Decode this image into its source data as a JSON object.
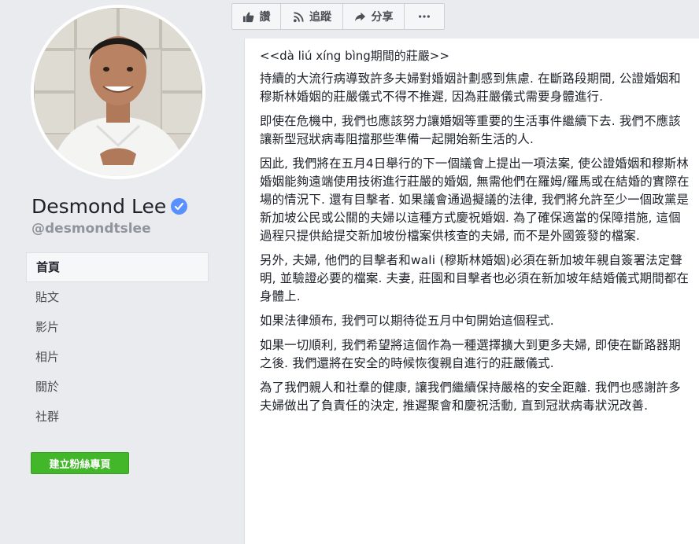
{
  "profile": {
    "name": "Desmond Lee",
    "handle": "@desmondtslee",
    "verified": true,
    "accent_color": "#5890ff"
  },
  "nav": {
    "items": [
      {
        "label": "首頁",
        "active": true
      },
      {
        "label": "貼文"
      },
      {
        "label": "影片"
      },
      {
        "label": "相片"
      },
      {
        "label": "關於"
      },
      {
        "label": "社群"
      }
    ]
  },
  "create_page_button": {
    "label": "建立粉絲專頁",
    "color": "#42b72a"
  },
  "actions": [
    {
      "label": "讚",
      "icon": "thumbs-up-icon"
    },
    {
      "label": "追蹤",
      "icon": "rss-follow-icon"
    },
    {
      "label": "分享",
      "icon": "share-arrow-icon"
    },
    {
      "label": "",
      "icon": "more-dots-icon"
    }
  ],
  "post": {
    "title": "<<dà liú xíng bìng期間的莊嚴>>",
    "paragraphs": [
      "持續的大流行病導致許多夫婦對婚姻計劃感到焦慮. 在斷路段期間, 公證婚姻和穆斯林婚姻的莊嚴儀式不得不推遲, 因為莊嚴儀式需要身體進行.",
      "即使在危機中, 我們也應該努力讓婚姻等重要的生活事件繼續下去. 我們不應該讓新型冠狀病毒阻擋那些準備一起開始新生活的人.",
      "因此, 我們將在五月4日舉行的下一個議會上提出一項法案, 使公證婚姻和穆斯林婚姻能夠遠端使用技術進行莊嚴的婚姻, 無需他們在羅姆/羅馬或在結婚的實際在場的情況下. 還有目擊者. 如果議會通過擬議的法律, 我們將允許至少一個政黨是新加坡公民或公關的夫婦以這種方式慶祝婚姻. 為了確保適當的保障措施, 這個過程只提供給提交新加坡份檔案供核查的夫婦, 而不是外國簽發的檔案.",
      "另外, 夫婦, 他們的目擊者和wali (穆斯林婚姻)必須在新加坡年親自簽署法定聲明, 並驗證必要的檔案. 夫妻, 莊園和目擊者也必須在新加坡年結婚儀式期間都在身體上.",
      "如果法律頒布, 我們可以期待從五月中旬開始這個程式.",
      "如果一切順利, 我們希望將這個作為一種選擇擴大到更多夫婦, 即使在斷路器期之後. 我們還將在安全的時候恢復親自進行的莊嚴儀式.",
      "為了我們親人和社羣的健康, 讓我們繼續保持嚴格的安全距離. 我們也感謝許多夫婦做出了負責任的決定, 推遲聚會和慶祝活動, 直到冠狀病毒狀況改善."
    ]
  }
}
